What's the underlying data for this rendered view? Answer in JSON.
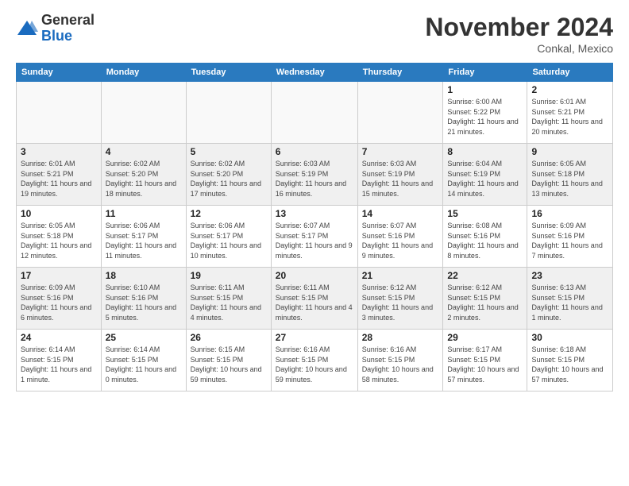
{
  "logo": {
    "general": "General",
    "blue": "Blue"
  },
  "title": "November 2024",
  "location": "Conkal, Mexico",
  "days_header": [
    "Sunday",
    "Monday",
    "Tuesday",
    "Wednesday",
    "Thursday",
    "Friday",
    "Saturday"
  ],
  "weeks": [
    [
      {
        "day": "",
        "info": ""
      },
      {
        "day": "",
        "info": ""
      },
      {
        "day": "",
        "info": ""
      },
      {
        "day": "",
        "info": ""
      },
      {
        "day": "",
        "info": ""
      },
      {
        "day": "1",
        "info": "Sunrise: 6:00 AM\nSunset: 5:22 PM\nDaylight: 11 hours and 21 minutes."
      },
      {
        "day": "2",
        "info": "Sunrise: 6:01 AM\nSunset: 5:21 PM\nDaylight: 11 hours and 20 minutes."
      }
    ],
    [
      {
        "day": "3",
        "info": "Sunrise: 6:01 AM\nSunset: 5:21 PM\nDaylight: 11 hours and 19 minutes."
      },
      {
        "day": "4",
        "info": "Sunrise: 6:02 AM\nSunset: 5:20 PM\nDaylight: 11 hours and 18 minutes."
      },
      {
        "day": "5",
        "info": "Sunrise: 6:02 AM\nSunset: 5:20 PM\nDaylight: 11 hours and 17 minutes."
      },
      {
        "day": "6",
        "info": "Sunrise: 6:03 AM\nSunset: 5:19 PM\nDaylight: 11 hours and 16 minutes."
      },
      {
        "day": "7",
        "info": "Sunrise: 6:03 AM\nSunset: 5:19 PM\nDaylight: 11 hours and 15 minutes."
      },
      {
        "day": "8",
        "info": "Sunrise: 6:04 AM\nSunset: 5:19 PM\nDaylight: 11 hours and 14 minutes."
      },
      {
        "day": "9",
        "info": "Sunrise: 6:05 AM\nSunset: 5:18 PM\nDaylight: 11 hours and 13 minutes."
      }
    ],
    [
      {
        "day": "10",
        "info": "Sunrise: 6:05 AM\nSunset: 5:18 PM\nDaylight: 11 hours and 12 minutes."
      },
      {
        "day": "11",
        "info": "Sunrise: 6:06 AM\nSunset: 5:17 PM\nDaylight: 11 hours and 11 minutes."
      },
      {
        "day": "12",
        "info": "Sunrise: 6:06 AM\nSunset: 5:17 PM\nDaylight: 11 hours and 10 minutes."
      },
      {
        "day": "13",
        "info": "Sunrise: 6:07 AM\nSunset: 5:17 PM\nDaylight: 11 hours and 9 minutes."
      },
      {
        "day": "14",
        "info": "Sunrise: 6:07 AM\nSunset: 5:16 PM\nDaylight: 11 hours and 9 minutes."
      },
      {
        "day": "15",
        "info": "Sunrise: 6:08 AM\nSunset: 5:16 PM\nDaylight: 11 hours and 8 minutes."
      },
      {
        "day": "16",
        "info": "Sunrise: 6:09 AM\nSunset: 5:16 PM\nDaylight: 11 hours and 7 minutes."
      }
    ],
    [
      {
        "day": "17",
        "info": "Sunrise: 6:09 AM\nSunset: 5:16 PM\nDaylight: 11 hours and 6 minutes."
      },
      {
        "day": "18",
        "info": "Sunrise: 6:10 AM\nSunset: 5:16 PM\nDaylight: 11 hours and 5 minutes."
      },
      {
        "day": "19",
        "info": "Sunrise: 6:11 AM\nSunset: 5:15 PM\nDaylight: 11 hours and 4 minutes."
      },
      {
        "day": "20",
        "info": "Sunrise: 6:11 AM\nSunset: 5:15 PM\nDaylight: 11 hours and 4 minutes."
      },
      {
        "day": "21",
        "info": "Sunrise: 6:12 AM\nSunset: 5:15 PM\nDaylight: 11 hours and 3 minutes."
      },
      {
        "day": "22",
        "info": "Sunrise: 6:12 AM\nSunset: 5:15 PM\nDaylight: 11 hours and 2 minutes."
      },
      {
        "day": "23",
        "info": "Sunrise: 6:13 AM\nSunset: 5:15 PM\nDaylight: 11 hours and 1 minute."
      }
    ],
    [
      {
        "day": "24",
        "info": "Sunrise: 6:14 AM\nSunset: 5:15 PM\nDaylight: 11 hours and 1 minute."
      },
      {
        "day": "25",
        "info": "Sunrise: 6:14 AM\nSunset: 5:15 PM\nDaylight: 11 hours and 0 minutes."
      },
      {
        "day": "26",
        "info": "Sunrise: 6:15 AM\nSunset: 5:15 PM\nDaylight: 10 hours and 59 minutes."
      },
      {
        "day": "27",
        "info": "Sunrise: 6:16 AM\nSunset: 5:15 PM\nDaylight: 10 hours and 59 minutes."
      },
      {
        "day": "28",
        "info": "Sunrise: 6:16 AM\nSunset: 5:15 PM\nDaylight: 10 hours and 58 minutes."
      },
      {
        "day": "29",
        "info": "Sunrise: 6:17 AM\nSunset: 5:15 PM\nDaylight: 10 hours and 57 minutes."
      },
      {
        "day": "30",
        "info": "Sunrise: 6:18 AM\nSunset: 5:15 PM\nDaylight: 10 hours and 57 minutes."
      }
    ]
  ]
}
